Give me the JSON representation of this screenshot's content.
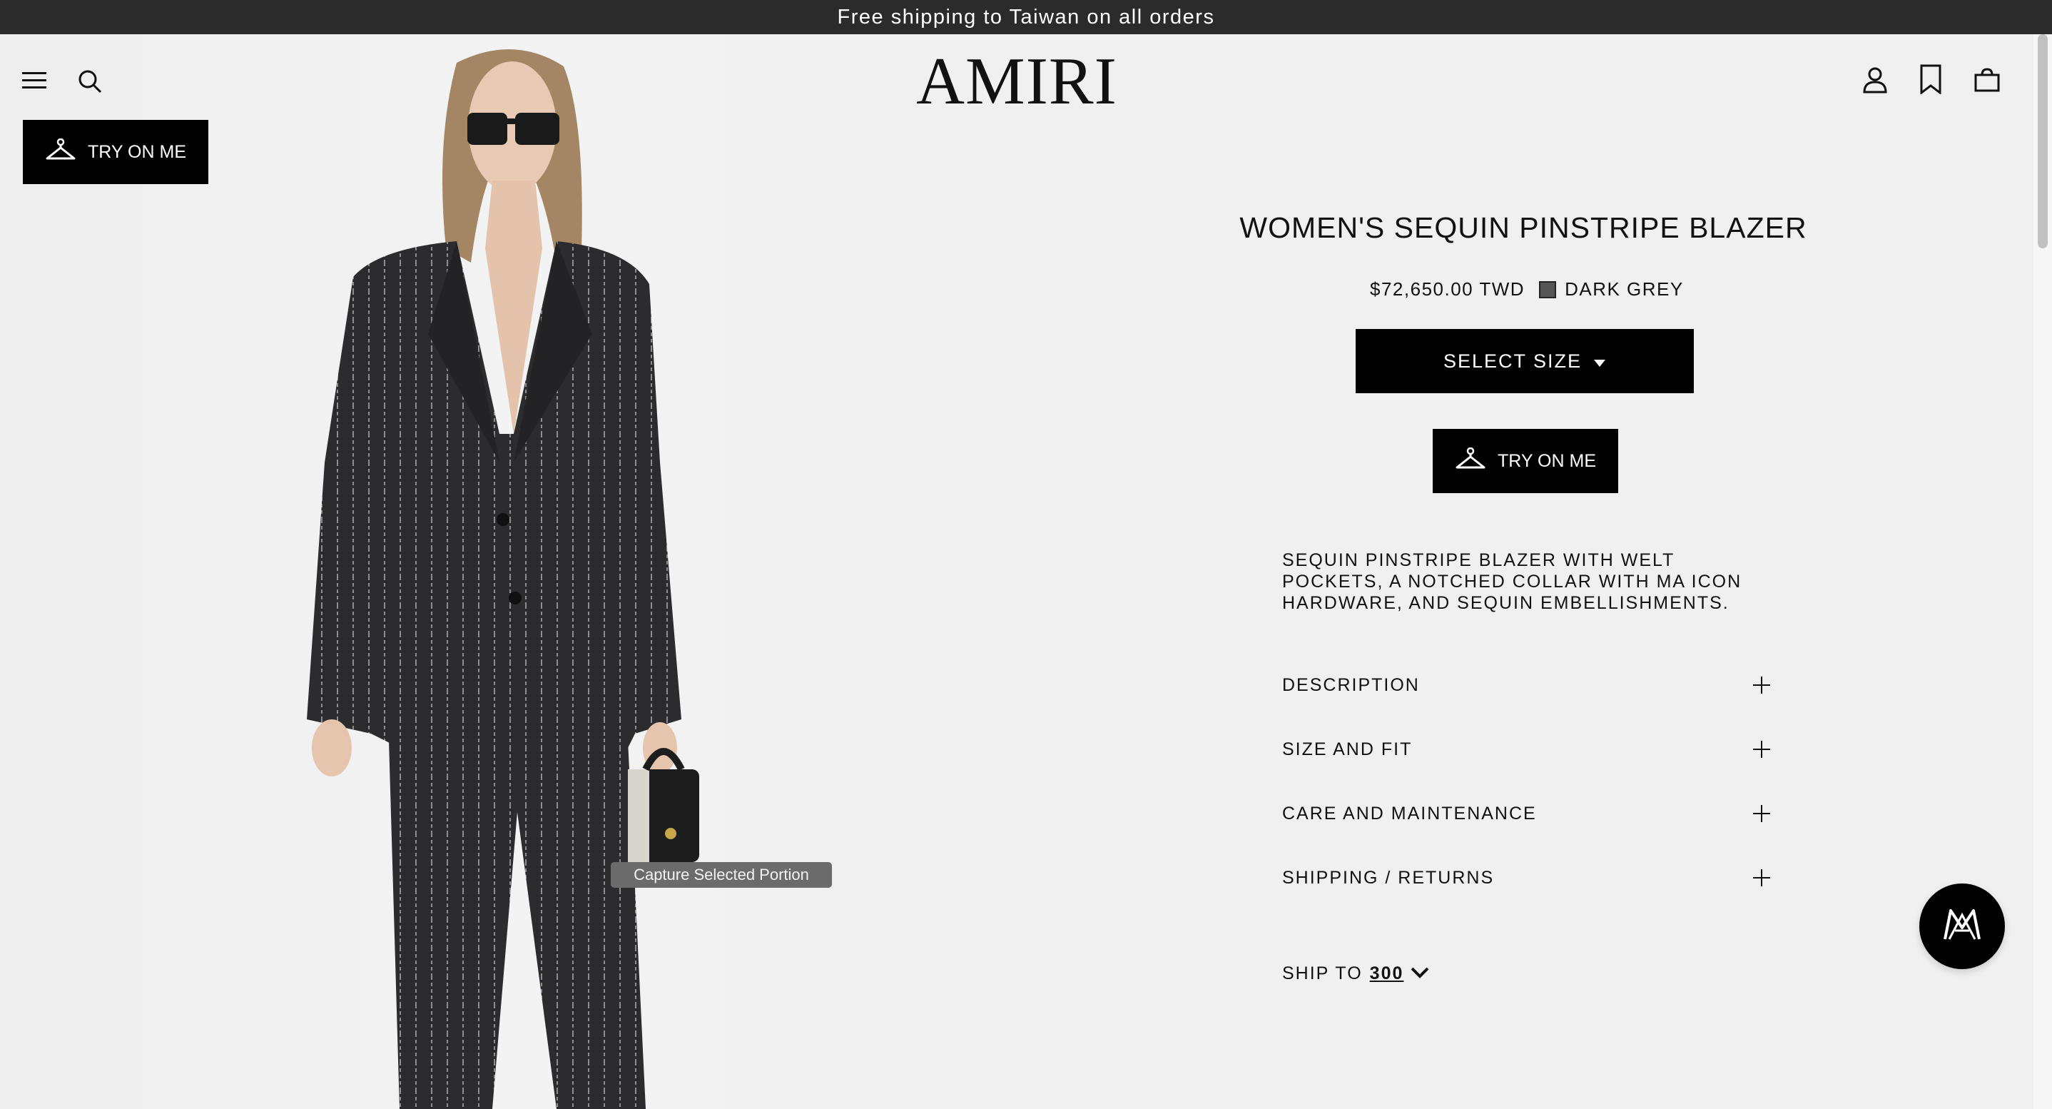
{
  "banner": {
    "text": "Free shipping to Taiwan on all orders"
  },
  "header": {
    "logo": "AMIRI",
    "icons": [
      "menu-icon",
      "search-icon",
      "account-icon",
      "bookmark-icon",
      "bag-icon"
    ]
  },
  "try_on": {
    "label": "TRY ON ME",
    "icon": "hanger-icon"
  },
  "product": {
    "title": "WOMEN'S SEQUIN PINSTRIPE BLAZER",
    "price": "$72,650.00 TWD",
    "color": "DARK GREY",
    "color_hex": "#555555",
    "select_size": "SELECT SIZE",
    "blurb": "SEQUIN PINSTRIPE BLAZER WITH WELT POCKETS, A NOTCHED COLLAR WITH MA ICON HARDWARE, AND SEQUIN EMBELLISHMENTS.",
    "accordion": [
      {
        "label": "DESCRIPTION"
      },
      {
        "label": "SIZE AND FIT"
      },
      {
        "label": "CARE AND MAINTENANCE"
      },
      {
        "label": "SHIPPING / RETURNS"
      }
    ],
    "ship_to": {
      "label": "SHIP TO",
      "value": "300"
    }
  },
  "tooltip": {
    "text": "Capture Selected Portion"
  },
  "chat": {
    "icon": "ma-monogram-icon"
  }
}
